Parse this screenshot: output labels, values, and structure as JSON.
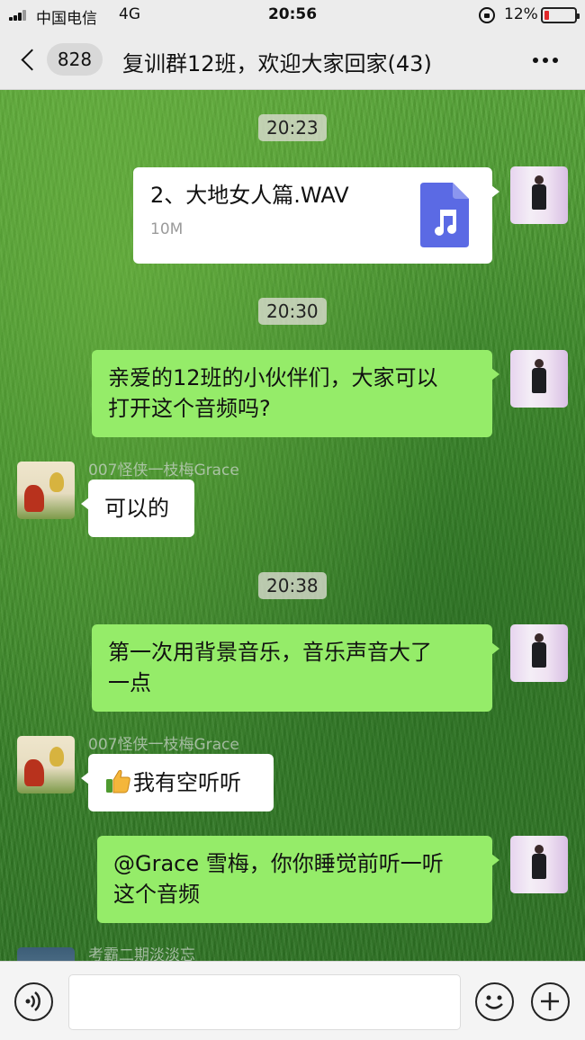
{
  "status_bar": {
    "carrier": "中国电信",
    "network": "4G",
    "time": "20:56",
    "battery": "12%",
    "battery_color": "#e0292b"
  },
  "header": {
    "back_icon": "chevron-left-icon",
    "unread_count": "828",
    "title": "复训群12班，欢迎大家回家(43)",
    "more_icon": "more-dots-icon"
  },
  "messages": [
    {
      "type": "time",
      "text": "20:23"
    },
    {
      "type": "file",
      "side": "right",
      "file_name": "2、大地女人篇.WAV",
      "file_size": "10M",
      "icon": "music-file-icon"
    },
    {
      "type": "time",
      "text": "20:30"
    },
    {
      "type": "text",
      "side": "right",
      "lines": [
        "亲爱的12班的小伙伴们，大家可以",
        "打开这个音频吗?"
      ]
    },
    {
      "type": "text",
      "side": "left",
      "sender": "007怪侠一枝梅Grace",
      "text": "可以的"
    },
    {
      "type": "time",
      "text": "20:38"
    },
    {
      "type": "text",
      "side": "right",
      "lines": [
        "第一次用背景音乐，音乐声音大了",
        "一点"
      ]
    },
    {
      "type": "text",
      "side": "left",
      "sender": "007怪侠一枝梅Grace",
      "text": "我有空听听",
      "icon": "thumbs-up-icon"
    },
    {
      "type": "text",
      "side": "right",
      "lines": [
        "@Grace 雪梅，你你睡觉前听一听",
        "这个音频"
      ]
    },
    {
      "type": "partial",
      "side": "left",
      "sender": "考霸二期淡淡忘"
    }
  ],
  "colors": {
    "bubble_self": "#95ec69",
    "bubble_other": "#ffffff",
    "file_icon": "#5b6ae4"
  },
  "input_bar": {
    "voice_icon": "voice-icon",
    "emoji_icon": "emoji-icon",
    "add_icon": "add-icon",
    "message_value": ""
  }
}
